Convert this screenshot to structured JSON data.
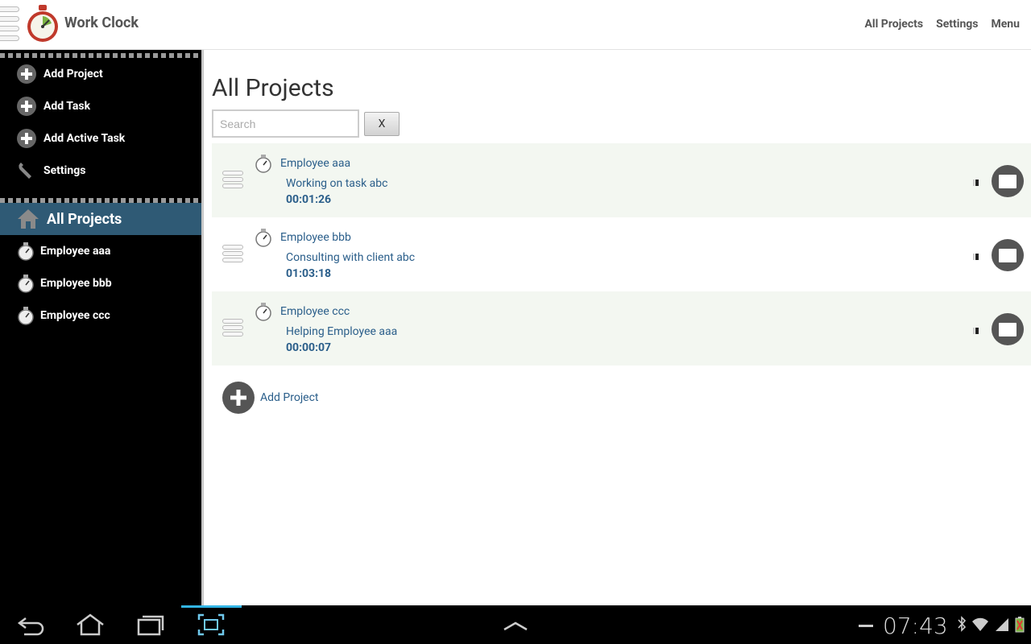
{
  "app": {
    "title": "Work Clock"
  },
  "top_menu": [
    "All Projects",
    "Settings",
    "Menu"
  ],
  "sidebar": {
    "actions": [
      {
        "label": "Add Project",
        "icon": "plus-circle-icon"
      },
      {
        "label": "Add Task",
        "icon": "plus-circle-icon"
      },
      {
        "label": "Add Active Task",
        "icon": "plus-circle-icon"
      },
      {
        "label": "Settings",
        "icon": "wrench-icon"
      }
    ],
    "active": {
      "label": "All Projects",
      "icon": "home-icon"
    },
    "employees": [
      "Employee aaa",
      "Employee bbb",
      "Employee ccc"
    ]
  },
  "main": {
    "title": "All Projects",
    "search": {
      "placeholder": "Search",
      "value": ""
    },
    "clear_label": "X",
    "rows": [
      {
        "employee": "Employee aaa",
        "task": "Working on task abc",
        "time": "00:01:26"
      },
      {
        "employee": "Employee bbb",
        "task": "Consulting with client abc",
        "time": "01:03:18"
      },
      {
        "employee": "Employee ccc",
        "task": "Helping Employee aaa",
        "time": "00:00:07"
      }
    ],
    "add_project_label": "Add Project"
  },
  "statusbar": {
    "time": "07:43"
  },
  "colors": {
    "accent": "#2f5a75",
    "link": "#2a5e8a",
    "sidebar_bg": "#000000"
  }
}
